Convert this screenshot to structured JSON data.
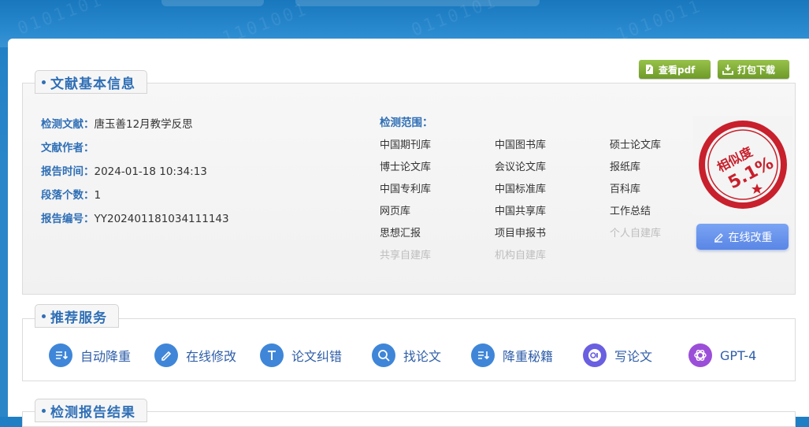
{
  "actions": {
    "view_pdf": "查看pdf",
    "download": "打包下载"
  },
  "info_section": {
    "title": "文献基本信息",
    "fields": [
      {
        "label": "检测文献：",
        "value": "唐玉善12月教学反思"
      },
      {
        "label": "文献作者：",
        "value": ""
      },
      {
        "label": "报告时间：",
        "value": "2024-01-18 10:34:13"
      },
      {
        "label": "段落个数：",
        "value": "1"
      },
      {
        "label": "报告编号：",
        "value": "YY202401181034111143"
      }
    ],
    "scope_title": "检测范围：",
    "scope_items": [
      {
        "label": "中国期刊库",
        "enabled": true
      },
      {
        "label": "中国图书库",
        "enabled": true
      },
      {
        "label": "硕士论文库",
        "enabled": true
      },
      {
        "label": "博士论文库",
        "enabled": true
      },
      {
        "label": "会议论文库",
        "enabled": true
      },
      {
        "label": "报纸库",
        "enabled": true
      },
      {
        "label": "中国专利库",
        "enabled": true
      },
      {
        "label": "中国标准库",
        "enabled": true
      },
      {
        "label": "百科库",
        "enabled": true
      },
      {
        "label": "网页库",
        "enabled": true
      },
      {
        "label": "中国共享库",
        "enabled": true
      },
      {
        "label": "工作总结",
        "enabled": true
      },
      {
        "label": "思想汇报",
        "enabled": true
      },
      {
        "label": "项目申报书",
        "enabled": true
      },
      {
        "label": "个人自建库",
        "enabled": false
      },
      {
        "label": "共享自建库",
        "enabled": false
      },
      {
        "label": "机构自建库",
        "enabled": false
      }
    ],
    "similarity": {
      "label": "相似度",
      "value": "5.1%",
      "color": "#c8202c"
    },
    "online_edit": "在线改重"
  },
  "services_section": {
    "title": "推荐服务",
    "items": [
      {
        "label": "自动降重",
        "icon": "auto-reduce-icon"
      },
      {
        "label": "在线修改",
        "icon": "pencil-icon"
      },
      {
        "label": "论文纠错",
        "icon": "text-t-icon"
      },
      {
        "label": "找论文",
        "icon": "search-icon"
      },
      {
        "label": "降重秘籍",
        "icon": "sort-down-icon"
      },
      {
        "label": "写论文",
        "icon": "ai-icon"
      },
      {
        "label": "GPT-4",
        "icon": "openai-icon"
      }
    ]
  },
  "results_section": {
    "title": "检测报告结果"
  },
  "colors": {
    "accent": "#2f6fb6",
    "green_button": "#7ba637",
    "edit_button": "#6890ec"
  }
}
